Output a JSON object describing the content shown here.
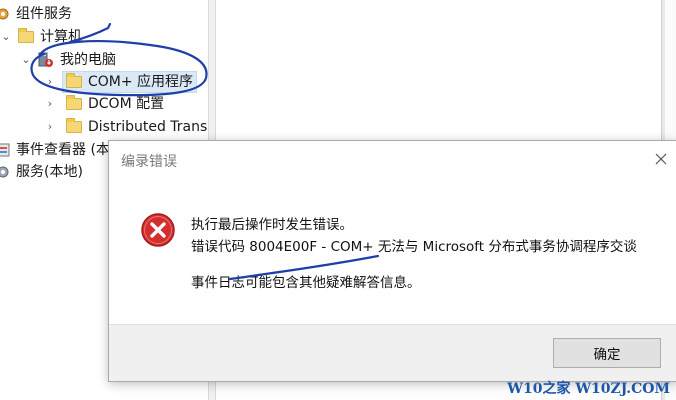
{
  "tree": {
    "items": [
      {
        "label": "组件服务"
      },
      {
        "label": "计算机"
      },
      {
        "label": "我的电脑"
      },
      {
        "label": "COM+ 应用程序"
      },
      {
        "label": "DCOM 配置"
      },
      {
        "label": "Distributed Trans"
      },
      {
        "label": "事件查看器 (本"
      },
      {
        "label": "服务(本地)"
      }
    ]
  },
  "dialog": {
    "title": "编录错误",
    "line1": "执行最后操作时发生错误。",
    "line2": "错误代码 8004E00F - COM+ 无法与 Microsoft 分布式事务协调程序交谈",
    "line3": "事件日志可能包含其他疑难解答信息。",
    "ok_label": "确定"
  },
  "watermark": "W10之家 W10ZJ.COM",
  "colors": {
    "annotation_ink": "#1f3fa8",
    "selection": "#dbe8f5",
    "error_red": "#d32f2f"
  }
}
